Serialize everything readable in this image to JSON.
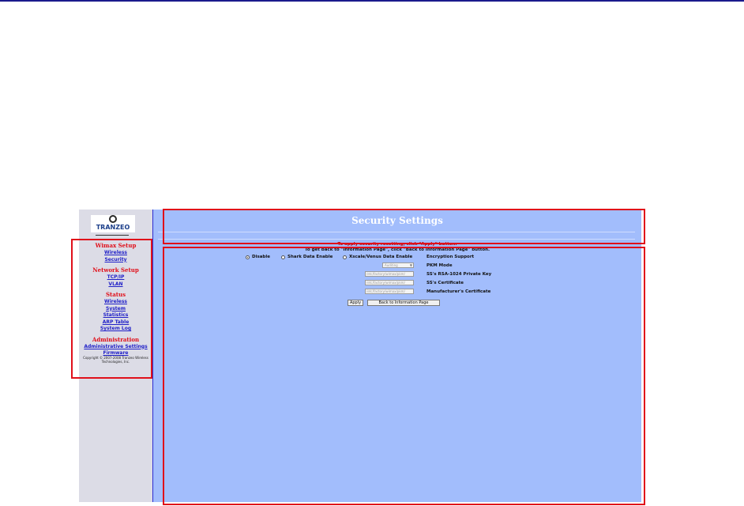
{
  "sidebar": {
    "logo_text": "TRANZEO",
    "sections": [
      {
        "title": "Wimax Setup",
        "links": [
          "Wireless",
          "Security"
        ]
      },
      {
        "title": "Network Setup",
        "links": [
          "TCP/IP",
          "VLAN"
        ]
      },
      {
        "title": "Status",
        "links": [
          "Wireless",
          "System",
          "Statistics",
          "ARP Table",
          "System Log"
        ]
      },
      {
        "title": "Administration",
        "links": [
          "Administrative Settings",
          "Firmware"
        ]
      }
    ],
    "copyright": "Copyright © 2007-2008 Tranzeo Wireless Technologies, Inc."
  },
  "main": {
    "title": "Security Settings",
    "msg_apply": "To apply security resetting, click \"Apply\" button.",
    "msg_back": "To get back to \"Information Page\", click \"Back to Information Page\" button.",
    "encryption": {
      "options": [
        "Disable",
        "Shark Data Enable",
        "Xscale/Venus Data Enable"
      ],
      "selected": "Disable",
      "label": "Encryption Support"
    },
    "pkm": {
      "value": "Auditing",
      "label": "PKM Mode"
    },
    "private_key": {
      "value": "/etc/factory/wimax/pkm/",
      "label": "SS's RSA-1024 Private Key"
    },
    "ss_cert": {
      "value": "/etc/factory/wimax/pkm/",
      "label": "SS's Certificate"
    },
    "mfr_cert": {
      "value": "/etc/factory/wimax/pkm/",
      "label": "Manufacturer's Certificate"
    },
    "apply_label": "Apply",
    "back_label": "Back to Information Page"
  },
  "colors": {
    "main_bg": "#a2bdfc",
    "sidebar_bg": "#dcdce6",
    "highlight": "#e0101a",
    "link": "#2020c8"
  }
}
